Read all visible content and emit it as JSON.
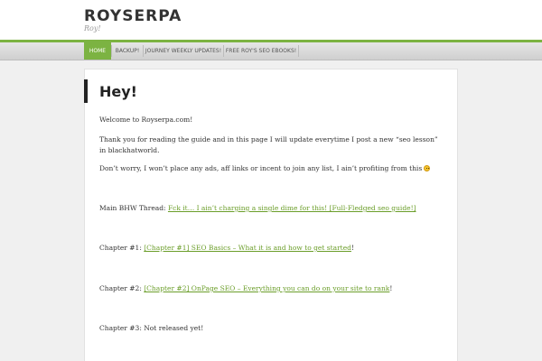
{
  "header": {
    "site_title": "ROYSERPA",
    "site_description": "Roy!"
  },
  "nav": {
    "items": [
      {
        "label": "HOME",
        "active": true
      },
      {
        "label": "BACKUP!",
        "active": false
      },
      {
        "label": "JOURNEY WEEKLY UPDATES!",
        "active": false
      },
      {
        "label": "FREE ROY'S SEO EBOOKS!",
        "active": false
      }
    ]
  },
  "page": {
    "title": "Hey!",
    "welcome": "Welcome to Royserpa.com!",
    "intro": "Thank you for reading the guide and in this page I will update everytime I post a new “seo lesson” in blackhatworld.",
    "disclaimer": "Don’t worry, I won’t place any ads, aff links or incent to join any list, I ain’t profiting from this",
    "main_thread_label": "Main BHW Thread: ",
    "main_thread_link": "Fck it… I ain’t charging a single dime for this! [Full-Fledged seo guide!]",
    "chapter1_label": "Chapter #1: ",
    "chapter1_link": "[Chapter #1] SEO Basics – What it is and how to get started",
    "chapter1_suffix": "!",
    "chapter2_label": "Chapter #2: ",
    "chapter2_link": "[Chapter #2] OnPage SEO – Everything you can do on your site to rank",
    "chapter2_suffix": "!",
    "chapter3": "Chapter #3: Not released yet!"
  },
  "colors": {
    "accent": "#7cb342",
    "link": "#6b9e2a"
  }
}
